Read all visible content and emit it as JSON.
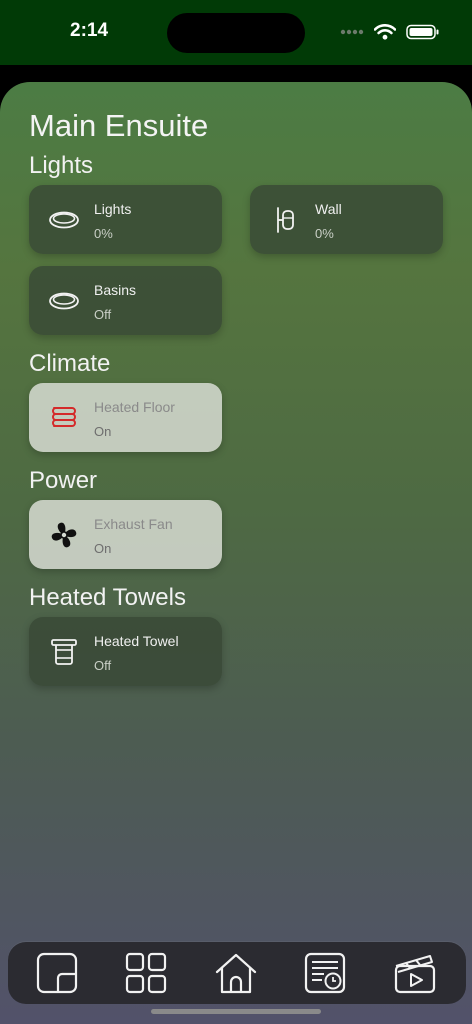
{
  "status": {
    "time": "2:14"
  },
  "room": {
    "title": "Main Ensuite"
  },
  "sections": {
    "lights": "Lights",
    "climate": "Climate",
    "power": "Power",
    "heated_towels": "Heated Towels"
  },
  "tiles": {
    "lights": {
      "name": "Lights",
      "state": "0%",
      "icon": "ceiling-light-icon"
    },
    "wall": {
      "name": "Wall",
      "state": "0%",
      "icon": "wall-light-icon"
    },
    "basins": {
      "name": "Basins",
      "state": "Off",
      "icon": "ceiling-light-icon"
    },
    "heated_floor": {
      "name": "Heated Floor",
      "state": "On",
      "icon": "heating-coil-icon"
    },
    "exhaust_fan": {
      "name": "Exhaust Fan",
      "state": "On",
      "icon": "fan-icon"
    },
    "heated_towel": {
      "name": "Heated Towel",
      "state": "Off",
      "icon": "towel-rail-icon"
    }
  },
  "tabbar": {
    "tabs": [
      "rooms-icon",
      "grid-icon",
      "home-icon",
      "schedule-icon",
      "scenes-icon"
    ]
  },
  "colors": {
    "accent_on": "#d6dbd2",
    "heating_red": "#d42a2a",
    "status_bar": "#013a06"
  }
}
